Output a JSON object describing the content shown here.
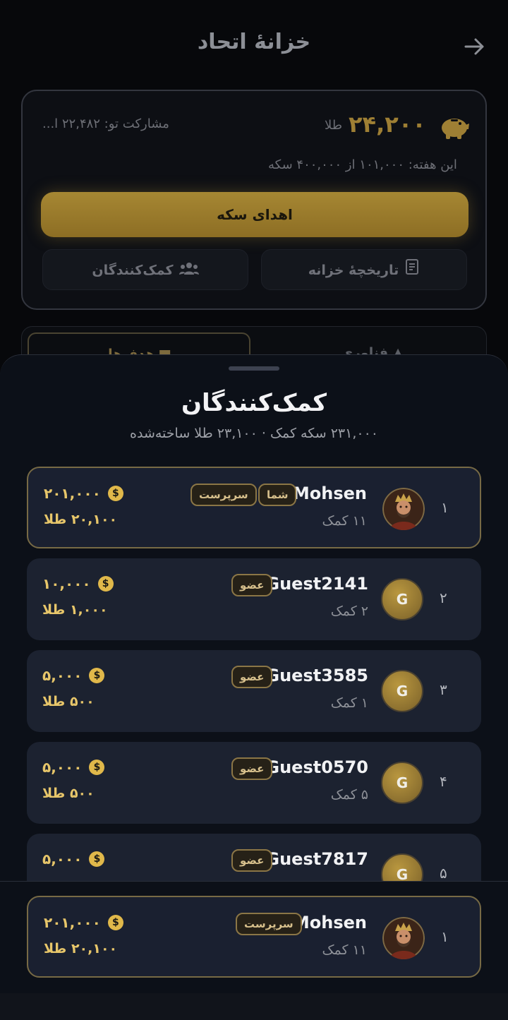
{
  "header": {
    "title": "خزانهٔ اتحاد"
  },
  "treasury": {
    "gold_amount": "۲۴,۲۰۰",
    "gold_unit": "طلا",
    "share_text": "مشارکت تو: ۲۲,۴۸۲ ا...",
    "week_text": "این هفته: ۱۰۱,۰۰۰ از ۴۰۰,۰۰۰ سکه",
    "donate_label": "اهدای سکه",
    "history_label": "تاریخچهٔ خزانه",
    "helpers_label": "کمک‌کنندگان"
  },
  "tabs": [
    {
      "label": "هدف‌ها"
    },
    {
      "label": "فناوری"
    }
  ],
  "sheet": {
    "title": "کمک‌کنندگان",
    "subtitle": "۲۳۱,۰۰۰ سکه کمک · ۲۳,۱۰۰ طلا ساخته‌شده"
  },
  "contributors": [
    {
      "rank": "۱",
      "name": "Mohsen",
      "helps": "۱۱ کمک",
      "badges": [
        "شما",
        "سرپرست"
      ],
      "coins": "۲۰۱,۰۰۰",
      "gold": "۲۰,۱۰۰ طلا",
      "avatar": "portrait",
      "highlight": true
    },
    {
      "rank": "۲",
      "name": "Guest2141",
      "helps": "۲ کمک",
      "badges": [
        "عضو"
      ],
      "coins": "۱۰,۰۰۰",
      "gold": "۱,۰۰۰ طلا",
      "avatar": "G",
      "highlight": false
    },
    {
      "rank": "۳",
      "name": "Guest3585",
      "helps": "۱ کمک",
      "badges": [
        "عضو"
      ],
      "coins": "۵,۰۰۰",
      "gold": "۵۰۰ طلا",
      "avatar": "G",
      "highlight": false
    },
    {
      "rank": "۴",
      "name": "Guest0570",
      "helps": "۵ کمک",
      "badges": [
        "عضو"
      ],
      "coins": "۵,۰۰۰",
      "gold": "۵۰۰ طلا",
      "avatar": "G",
      "highlight": false
    },
    {
      "rank": "۵",
      "name": "Guest7817",
      "helps": "",
      "badges": [
        "عضو"
      ],
      "coins": "۵,۰۰۰",
      "gold": "",
      "avatar": "G",
      "highlight": false
    }
  ],
  "my_row": {
    "rank": "۱",
    "name": "Mohsen",
    "helps": "۱۱ کمک",
    "badge": "سرپرست",
    "coins": "۲۰۱,۰۰۰",
    "gold": "۲۰,۱۰۰ طلا"
  },
  "colors": {
    "accent_gold": "#e7c66a",
    "button_gold": "#a68733",
    "card_bg": "#1c2230"
  }
}
